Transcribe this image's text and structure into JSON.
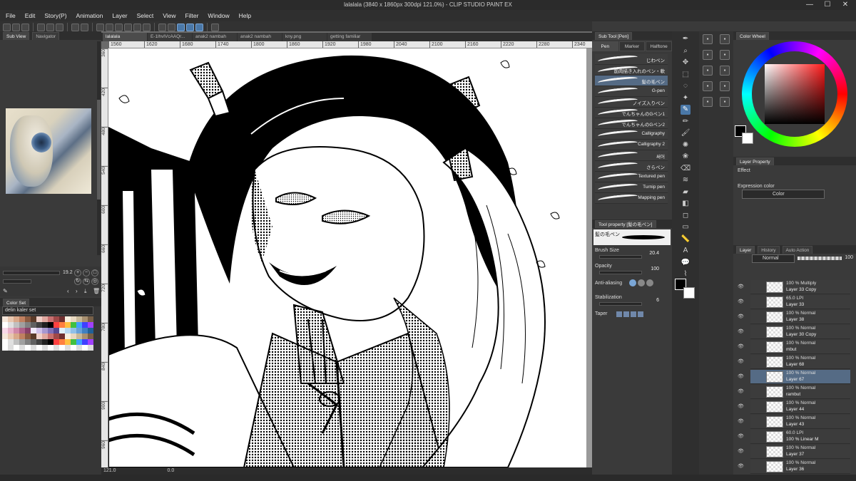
{
  "window": {
    "title": "lalalala (3840 x 1860px 300dpi 121.0%) - CLIP STUDIO PAINT EX",
    "min": "—",
    "max": "☐",
    "close": "✕"
  },
  "menu": [
    "File",
    "Edit",
    "Story(P)",
    "Animation",
    "Layer",
    "Select",
    "View",
    "Filter",
    "Window",
    "Help"
  ],
  "left_panel": {
    "tabs": [
      "Sub View",
      "Navigator"
    ],
    "zoom_value": "19.2",
    "colorset_tab": "Color Set",
    "colorset_name": "delin kaler set"
  },
  "doc_tabs": [
    "lalalala",
    "E-1lhvlVcAAQr...",
    "anak2 nambah",
    "anak2 nambah",
    "kny.png",
    "getting familiar"
  ],
  "ruler_h": [
    "1560",
    "1620",
    "1680",
    "1740",
    "1800",
    "1860",
    "1920",
    "1980",
    "2040",
    "2100",
    "2160",
    "2220",
    "2280",
    "2340"
  ],
  "ruler_v": [
    "360",
    "420",
    "480",
    "540",
    "600",
    "660",
    "720",
    "780",
    "840",
    "900",
    "960"
  ],
  "canvas_status": {
    "zoom": "121.0",
    "angle": "0.0"
  },
  "subtool": {
    "header": "Sub Tool [Pen]",
    "tabs": [
      "Pen",
      "Marker",
      "Halftone"
    ],
    "brushes": [
      "じわペン",
      "筋肉描き入れのペン・軟",
      "髪の毛ペン",
      "G-pen",
      "ノイズ入りペン",
      "でんちゃんのGペン1",
      "でんちゃんのGペン2",
      "Calligraphy",
      "Calligraphy 2",
      "써어",
      "さらペン",
      "Textured pen",
      "Turnip pen",
      "Mapping pen"
    ],
    "selected_index": 2
  },
  "tool_property": {
    "header": "Tool property [髪の毛ペン]",
    "brush_name": "髪の毛ペン",
    "brush_size_label": "Brush Size",
    "brush_size": "20.4",
    "opacity_label": "Opacity",
    "opacity": "100",
    "aa_label": "Anti-aliasing",
    "stab_label": "Stabilization",
    "stab": "6",
    "taper_label": "Taper"
  },
  "color_wheel": {
    "header": "Color Wheel"
  },
  "layer_property": {
    "header": "Layer Property",
    "effect_label": "Effect",
    "expression_label": "Expression color",
    "expression_value": "Color"
  },
  "layer_panel": {
    "tabs": [
      "Layer",
      "History",
      "Auto Action"
    ],
    "blend": "Normal",
    "opacity": "100",
    "layers": [
      {
        "blend": "100 % Multiply",
        "name": "Layer 33 Copy"
      },
      {
        "blend": "65.0 LPI",
        "name": "Layer 33"
      },
      {
        "blend": "100 % Normal",
        "name": "Layer 38"
      },
      {
        "blend": "100 % Normal",
        "name": "Layer 30 Copy"
      },
      {
        "blend": "100 % Normal",
        "name": "mbut"
      },
      {
        "blend": "100 % Normal",
        "name": "Layer 68"
      },
      {
        "blend": "100 % Normal",
        "name": "Layer 67"
      },
      {
        "blend": "100 % Normal",
        "name": "rambut"
      },
      {
        "blend": "100 % Normal",
        "name": "Layer 44"
      },
      {
        "blend": "100 % Normal",
        "name": "Layer 43"
      },
      {
        "blend": "60.0 LPI",
        "name": "100 % Linear M"
      },
      {
        "blend": "100 % Normal",
        "name": "Layer 37"
      },
      {
        "blend": "100 % Normal",
        "name": "Layer 36"
      }
    ],
    "selected_index": 6
  },
  "colors": {
    "accent": "#4a78a8",
    "selected_row": "#556b85",
    "panel": "#3a3a3a"
  }
}
